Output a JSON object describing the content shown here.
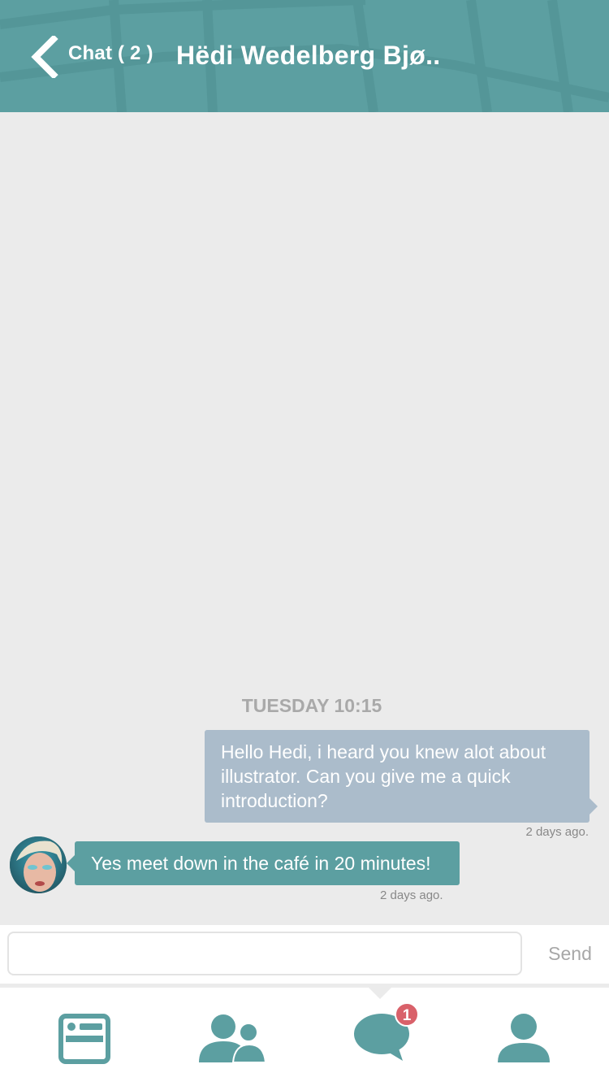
{
  "header": {
    "back_label": "Chat ( 2 )",
    "title": "Hëdi Wedelberg Bjø..",
    "background_color": "#5c9fa1",
    "back_icon": "chevron-left-icon"
  },
  "conversation": {
    "day_separator": "TUESDAY 10:15",
    "messages": [
      {
        "direction": "outgoing",
        "text": "Hello Hedi, i heard you knew alot about illustrator. Can you give me a quick introduction?",
        "timestamp": "2 days ago.",
        "bubble_color": "#abbccb"
      },
      {
        "direction": "incoming",
        "text": "Yes meet down in the café in 20 minutes!",
        "timestamp": "2 days ago.",
        "bubble_color": "#5c9fa1",
        "avatar": "contact-avatar"
      }
    ]
  },
  "composer": {
    "input_value": "",
    "input_placeholder": "",
    "send_label": "Send"
  },
  "tabbar": {
    "tabs": [
      {
        "icon": "news-feed-icon",
        "active": false
      },
      {
        "icon": "contacts-icon",
        "active": false
      },
      {
        "icon": "chat-bubble-icon",
        "active": true,
        "badge": "1"
      },
      {
        "icon": "profile-icon",
        "active": false
      }
    ],
    "icon_color": "#5c9fa1",
    "badge_color": "#d9616a"
  }
}
